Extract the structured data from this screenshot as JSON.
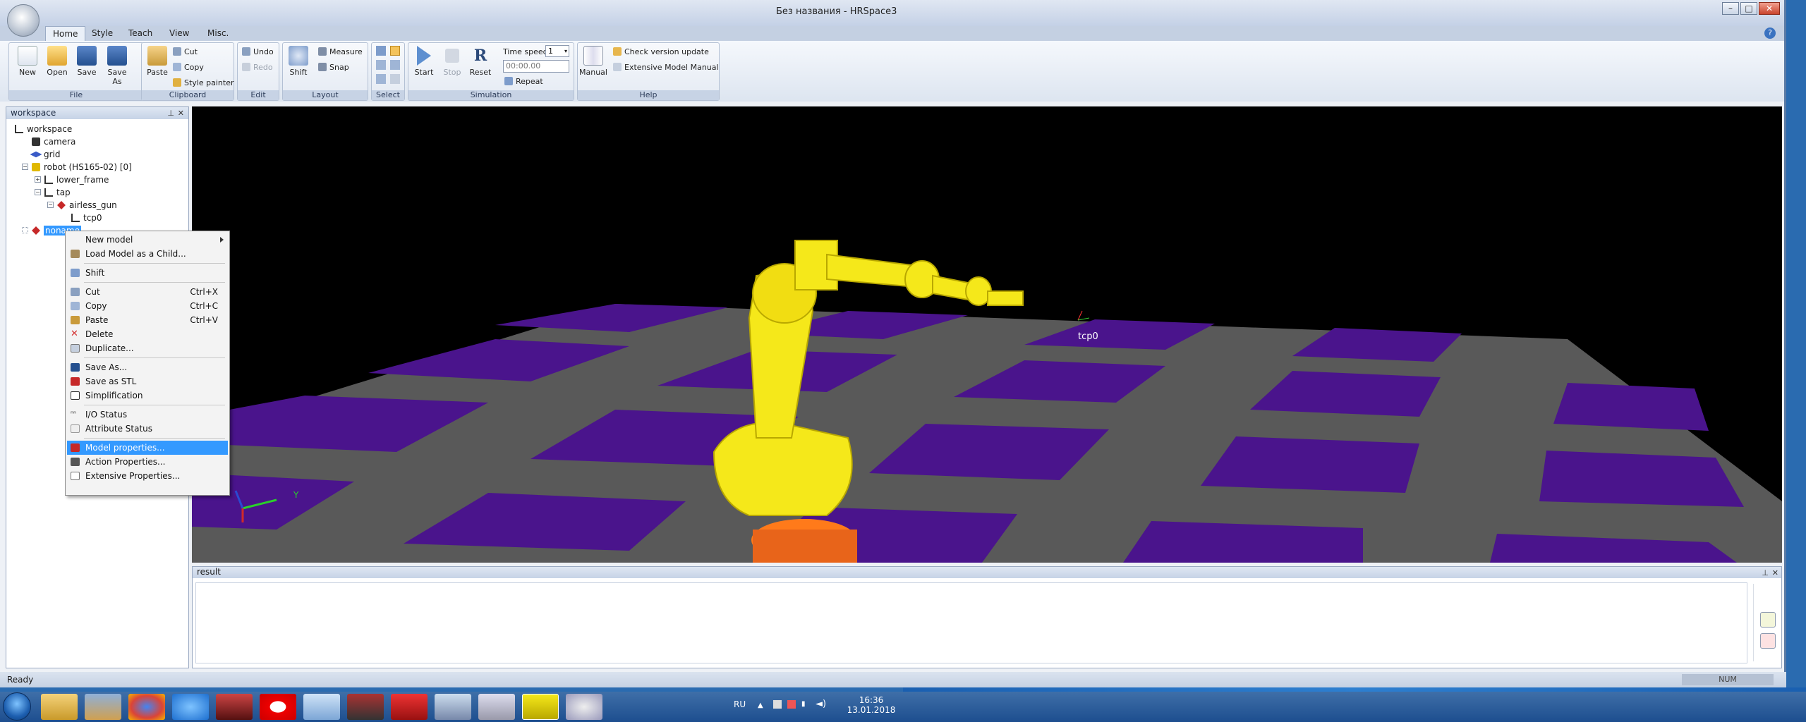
{
  "window": {
    "title": "Без названия - HRSpace3",
    "controls": [
      "minimize",
      "maximize",
      "close"
    ]
  },
  "tabs": [
    "Home",
    "Style",
    "Teach",
    "View",
    "Misc."
  ],
  "ribbon": {
    "file": {
      "caption": "File",
      "new": "New",
      "open": "Open",
      "save": "Save",
      "save_as": "Save As"
    },
    "clipboard": {
      "caption": "Clipboard",
      "paste": "Paste",
      "cut": "Cut",
      "copy": "Copy",
      "style_painter": "Style painter"
    },
    "edit": {
      "caption": "Edit",
      "undo": "Undo",
      "redo": "Redo"
    },
    "layout": {
      "caption": "Layout",
      "shift": "Shift",
      "measure": "Measure",
      "snap": "Snap"
    },
    "select": {
      "caption": "Select"
    },
    "simulation": {
      "caption": "Simulation",
      "start": "Start",
      "stop": "Stop",
      "reset": "Reset",
      "time_speed_label": "Time speed",
      "time_speed_value": "1",
      "time_value": "00:00.00",
      "repeat": "Repeat"
    },
    "help": {
      "caption": "Help",
      "manual": "Manual",
      "check_update": "Check version update",
      "extensive_manual": "Extensive Model Manual"
    }
  },
  "workspace_panel": {
    "title": "workspace",
    "tree": [
      {
        "label": "workspace",
        "level": 0
      },
      {
        "label": "camera",
        "level": 1
      },
      {
        "label": "grid",
        "level": 1
      },
      {
        "label": "robot (HS165-02) [0]",
        "level": 1
      },
      {
        "label": "lower_frame",
        "level": 2
      },
      {
        "label": "tap",
        "level": 2
      },
      {
        "label": "airless_gun",
        "level": 3
      },
      {
        "label": "tcp0",
        "level": 4
      },
      {
        "label": "noname",
        "level": 1,
        "selected": true
      }
    ]
  },
  "context_menu": {
    "items": [
      {
        "label": "New model",
        "submenu": true
      },
      {
        "label": "Load Model as a Child..."
      },
      {
        "label": "Shift"
      },
      {
        "label": "Cut",
        "shortcut": "Ctrl+X"
      },
      {
        "label": "Copy",
        "shortcut": "Ctrl+C"
      },
      {
        "label": "Paste",
        "shortcut": "Ctrl+V"
      },
      {
        "label": "Delete"
      },
      {
        "label": "Duplicate..."
      },
      {
        "label": "Save As..."
      },
      {
        "label": "Save as STL"
      },
      {
        "label": "Simplification"
      },
      {
        "label": "I/O Status"
      },
      {
        "label": "Attribute Status"
      },
      {
        "label": "Model properties...",
        "highlighted": true
      },
      {
        "label": "Action Properties..."
      },
      {
        "label": "Extensive Properties..."
      }
    ]
  },
  "viewport": {
    "tcp_label": "tcp0",
    "axis_y_label": "Y",
    "colors": {
      "floor_dark": "#4a148c",
      "floor_light": "#595959",
      "robot": "#f5e81a",
      "base": "#ff7a1a"
    }
  },
  "result_panel": {
    "title": "result"
  },
  "status_bar": {
    "text": "Ready",
    "indicator": "NUM"
  },
  "taskbar": {
    "language": "RU",
    "time": "16:36",
    "date": "13.01.2018"
  }
}
